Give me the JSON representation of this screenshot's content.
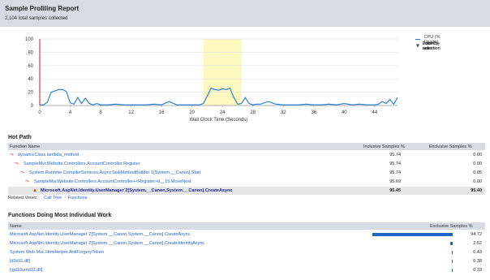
{
  "header": {
    "title": "Sample Profiling Report",
    "subtitle": "2,104 total samples collected"
  },
  "chart_data": {
    "type": "line",
    "xlabel": "Wall Clock Time (Seconds)",
    "ylabel": "",
    "xlim": [
      0,
      47
    ],
    "ylim": [
      0,
      100
    ],
    "x_ticks": [
      "0",
      "4",
      "8",
      "12",
      "16",
      "20",
      "24",
      "28",
      "32",
      "36",
      "40",
      "44"
    ],
    "y_ticks": [
      "0",
      "20",
      "40",
      "60",
      "80",
      "100"
    ],
    "selection": [
      21.5,
      26.5
    ],
    "series": [
      {
        "name": "CPU (% Usage)",
        "color": "#1e78d2",
        "x": [
          0,
          0.5,
          1,
          1.5,
          2,
          2.5,
          3,
          3.5,
          4,
          4.5,
          5,
          5.5,
          6,
          6.5,
          7,
          7.5,
          8,
          9,
          10,
          11,
          12,
          13,
          14,
          15,
          16,
          17,
          18,
          19,
          20,
          21,
          21.5,
          22,
          22.5,
          23,
          23.5,
          24,
          24.5,
          25,
          25.5,
          26,
          26.5,
          27,
          27.5,
          28,
          28.5,
          29,
          30,
          31,
          32,
          33,
          34,
          35,
          36,
          37,
          38,
          39,
          40,
          41,
          42,
          43,
          44,
          44.5,
          45,
          45.5,
          46,
          46.5,
          47
        ],
        "values": [
          1,
          1,
          5,
          20,
          22,
          24,
          24,
          21,
          4,
          2,
          12,
          3,
          11,
          3,
          1,
          3,
          1,
          1,
          2,
          1,
          1,
          1,
          1,
          2,
          1,
          6,
          1,
          1,
          1,
          1,
          3,
          14,
          26,
          24,
          23,
          25,
          24,
          26,
          12,
          2,
          3,
          12,
          3,
          1,
          2,
          2,
          6,
          2,
          1,
          1,
          1,
          2,
          1,
          1,
          2,
          1,
          3,
          1,
          2,
          1,
          1,
          2,
          6,
          3,
          9,
          2,
          12
        ]
      }
    ],
    "legend_position": "right"
  },
  "legend": {
    "cpu_label": "CPU (% Usage)",
    "actions": [
      {
        "icon": "filter-icon",
        "label": "Filter by selection"
      },
      {
        "icon": "filter-icon",
        "label": "Zoom by selection"
      },
      {
        "icon": "filter-icon",
        "label": "Zoom reset"
      },
      {
        "icon": "filter-icon",
        "label": "Zoom out"
      }
    ]
  },
  "hot_path": {
    "title": "Hot Path",
    "columns": [
      "Function Name",
      "Inclusive Samples %",
      "Exclusive Samples %"
    ],
    "rows": [
      {
        "name": "dynamicClass.lambda_method",
        "inclusive": "95.74",
        "exclusive": "0.00",
        "indent": 0
      },
      {
        "name": "SampleMvcWebsite.Controllers.AccountController.Register",
        "inclusive": "95.74",
        "exclusive": "0.00",
        "indent": 1
      },
      {
        "name": "System.Runtime.CompilerServices.AsyncTaskMethodBuilder`1[System.__Canon].Start",
        "inclusive": "95.74",
        "exclusive": "0.05",
        "indent": 2
      },
      {
        "name": "SampleMvcWebsite.Controllers.AccountController+<Register>d__15.MoveNext",
        "inclusive": "95.69",
        "exclusive": "0.00",
        "indent": 3
      },
      {
        "name": "Microsoft.AspNet.Identity.UserManager`2[System.__Canon,System.__Canon].CreateAsync",
        "inclusive": "95.45",
        "exclusive": "95.40",
        "indent": 4
      }
    ],
    "related_label": "Related Views:",
    "related_links": [
      "Call Tree",
      "Functions"
    ]
  },
  "individual_work": {
    "title": "Functions Doing Most Individual Work",
    "columns": [
      "Name",
      "Exclusive Samples %"
    ],
    "rows": [
      {
        "name": "Microsoft.AspNet.Identity.UserManager`2[System.__Canon,System.__Canon].CreateAsync",
        "value": "94.72",
        "pct": 94.72
      },
      {
        "name": "Microsoft.AspNet.Identity.UserManager`2[System.__Canon,System.__Canon].CreateIdentityAsync",
        "value": "2.52",
        "pct": 2.52
      },
      {
        "name": "System.Web.Mvc.HtmlHelper.AntiForgeryToken",
        "value": "0.43",
        "pct": 0.43
      },
      {
        "name": "[d3d11.dll]",
        "value": "0.38",
        "pct": 0.38
      },
      {
        "name": "[igd10umd32.dll]",
        "value": "0.33",
        "pct": 0.33
      }
    ]
  }
}
